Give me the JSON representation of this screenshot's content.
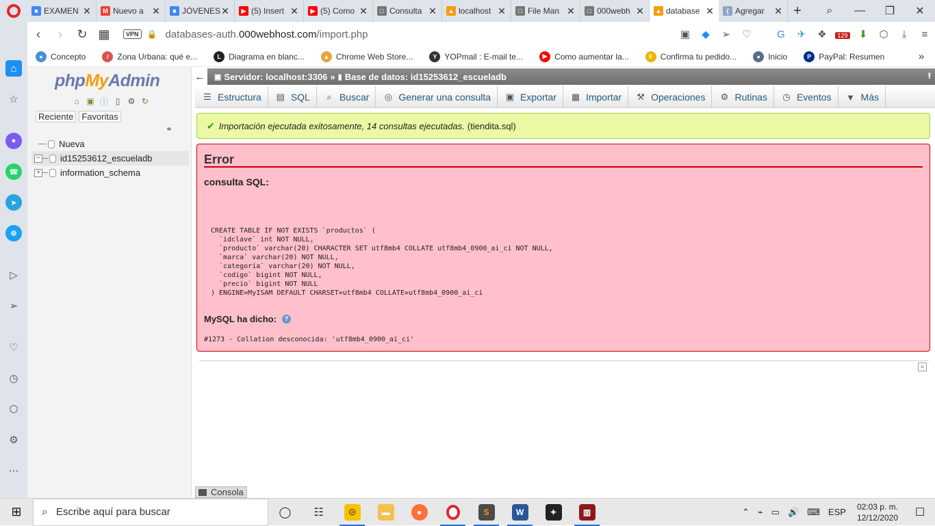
{
  "browser": {
    "tabs": [
      {
        "label": "EXAMEN",
        "fav_color": "#4285f4",
        "fav_glyph": "■"
      },
      {
        "label": "Nuevo a",
        "fav_color": "#ea4335",
        "fav_glyph": "M"
      },
      {
        "label": "JÓVENES",
        "fav_color": "#4285f4",
        "fav_glyph": "■"
      },
      {
        "label": "(5) Insert",
        "fav_color": "#ff0000",
        "fav_glyph": "▶"
      },
      {
        "label": "(5) Como",
        "fav_color": "#ff0000",
        "fav_glyph": "▶"
      },
      {
        "label": "Consulta",
        "fav_color": "#777777",
        "fav_glyph": "□"
      },
      {
        "label": "localhost",
        "fav_color": "#f89c0e",
        "fav_glyph": "▲"
      },
      {
        "label": "File Man",
        "fav_color": "#777777",
        "fav_glyph": "□"
      },
      {
        "label": "000webh",
        "fav_color": "#777777",
        "fav_glyph": "□"
      },
      {
        "label": "database",
        "fav_color": "#f89c0e",
        "fav_glyph": "▲",
        "active": true
      },
      {
        "label": "Agregar",
        "fav_color": "#8fa4c7",
        "fav_glyph": "{"
      }
    ],
    "new_tab": "+",
    "url_prefix": "databases-auth.",
    "url_host": "000webhost.com",
    "url_path": "/import.php",
    "vpn_label": "VPN",
    "notification_badge": "129",
    "bookmarks": [
      {
        "label": "Concepto",
        "color": "#4a90d9",
        "glyph": "●"
      },
      {
        "label": "Zona Urbana: qué e...",
        "color": "#d9534f",
        "glyph": "/"
      },
      {
        "label": "Diagrama en blanc...",
        "color": "#222222",
        "glyph": "L"
      },
      {
        "label": "Chrome Web Store...",
        "color": "#e8a33d",
        "glyph": "▲"
      },
      {
        "label": "YOPmail : E-mail te...",
        "color": "#333333",
        "glyph": "Y"
      },
      {
        "label": "Como aumentar la...",
        "color": "#ff0000",
        "glyph": "▶"
      },
      {
        "label": "Confirma tu pedido...",
        "color": "#f0b400",
        "glyph": "F"
      },
      {
        "label": "Inicio",
        "color": "#5a6b8c",
        "glyph": "●"
      },
      {
        "label": "PayPal: Resumen",
        "color": "#003087",
        "glyph": "P"
      }
    ]
  },
  "pma": {
    "logo_php": "php",
    "logo_my": "My",
    "logo_admin": "Admin",
    "nav_tabs": [
      "Reciente",
      "Favoritas"
    ],
    "tree": [
      {
        "label": "Nueva",
        "type": "new"
      },
      {
        "label": "id15253612_escueladb",
        "type": "db",
        "expanded": true
      },
      {
        "label": "information_schema",
        "type": "db",
        "expanded": false
      }
    ],
    "breadcrumb": {
      "server_label": "Servidor: localhost:3306",
      "separator": "»",
      "db_label": "Base de datos: id15253612_escueladb"
    },
    "menu": [
      {
        "label": "Estructura",
        "icon": "structure-icon",
        "glyph": "☰"
      },
      {
        "label": "SQL",
        "icon": "sql-icon",
        "glyph": "▤"
      },
      {
        "label": "Buscar",
        "icon": "search-icon",
        "glyph": "⌕"
      },
      {
        "label": "Generar una consulta",
        "icon": "query-icon",
        "glyph": "◎"
      },
      {
        "label": "Exportar",
        "icon": "export-icon",
        "glyph": "▣"
      },
      {
        "label": "Importar",
        "icon": "import-icon",
        "glyph": "▦"
      },
      {
        "label": "Operaciones",
        "icon": "wrench-icon",
        "glyph": "⚒"
      },
      {
        "label": "Rutinas",
        "icon": "routines-icon",
        "glyph": "⚙"
      },
      {
        "label": "Eventos",
        "icon": "clock-icon",
        "glyph": "◷"
      },
      {
        "label": "Más",
        "icon": "chevron-down-icon",
        "glyph": "▼"
      }
    ],
    "success_italic": "Importación ejecutada exitosamente, 14 consultas ejecutadas.",
    "success_file": "(tiendita.sql)",
    "error_title": "Error",
    "sql_heading": "consulta SQL:",
    "sql_code": "CREATE TABLE IF NOT EXISTS `productos` (\n  `idclave` int NOT NULL,\n  `producto` varchar(20) CHARACTER SET utf8mb4 COLLATE utf8mb4_0900_ai_ci NOT NULL,\n  `marca` varchar(20) NOT NULL,\n  `categoria` varchar(20) NOT NULL,\n  `codigo` bigint NOT NULL,\n  `precio` bigint NOT NULL\n) ENGINE=MyISAM DEFAULT CHARSET=utf8mb4 COLLATE=utf8mb4_0900_ai_ci",
    "mysql_said": "MySQL ha dicho:",
    "error_message": "#1273 - Collation desconocida: 'utf8mb4_0900_ai_ci'",
    "console_label": "Consola"
  },
  "taskbar": {
    "search_placeholder": "Escribe aquí para buscar",
    "language": "ESP",
    "time": "02:03 p. m.",
    "date": "12/12/2020"
  }
}
